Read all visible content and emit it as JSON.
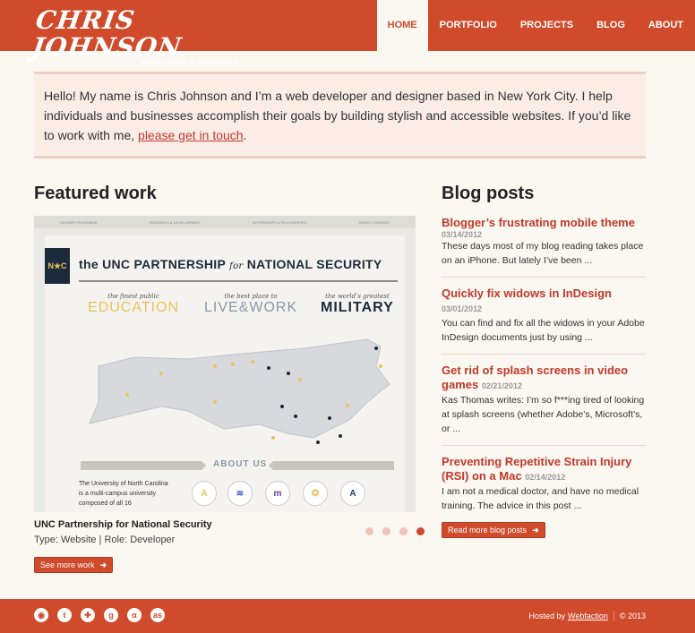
{
  "header": {
    "logo_name": "Chris Johnson",
    "logo_sub": "DEVELOPER & DESIGNER",
    "nav": [
      "HOME",
      "PORTFOLIO",
      "PROJECTS",
      "BLOG",
      "ABOUT"
    ],
    "active": "HOME"
  },
  "intro": {
    "text": "Hello! My name is Chris Johnson and I’m a web developer and designer based in New York City. I help individuals and businesses accomplish their goals by building stylish and accessible websites. If you’d like to work with me, ",
    "link": "please get in touch",
    "end": "."
  },
  "featured": {
    "heading": "Featured work",
    "project_title": "UNC Partnership for National Security",
    "meta": "Type: Website | Role: Developer",
    "button": "See more work",
    "slides_total": 4,
    "slide_active": 4,
    "screenshot": {
      "nav": [
        "DEGREE PROGRAMS",
        "RESEARCH & DEVELOPMENT",
        "INTERNSHIPS & FELLOWSHIPS",
        "SHORT COURSES"
      ],
      "logo": "N★C",
      "title_1": "the UNC PARTNERSHIP",
      "title_for": "for",
      "title_2": "NATIONAL SECURITY",
      "pillars": [
        {
          "small": "the finest public",
          "big": "EDUCATION",
          "color": "#e8c35c"
        },
        {
          "small": "the best place to",
          "big": "LIVE&WORK",
          "color": "#8a98a8"
        },
        {
          "small": "the world’s greatest",
          "big": "MILITARY",
          "color": "#1d2a3a"
        }
      ],
      "about": "ABOUT US",
      "about_text": "The University of North Carolina is a multi-campus university composed of all 16"
    }
  },
  "blog": {
    "heading": "Blog posts",
    "posts": [
      {
        "title": "Blogger’s frustrating mobile theme",
        "date": "03/14/2012",
        "text": "These days most of my blog reading takes place on an iPhone. But lately I’ve been ..."
      },
      {
        "title": "Quickly fix widows in InDesign",
        "date": "03/01/2012",
        "text": "You can find and fix all the widows in your Adobe InDesign documents just by using ..."
      },
      {
        "title": "Get rid of splash screens in video games",
        "date": "02/21/2012",
        "text": "Kas Thomas writes: I’m so f***ing tired of looking at splash screens (whether Adobe’s, Microsoft’s, or ..."
      },
      {
        "title": "Preventing Repetitive Strain Injury (RSI) on a Mac",
        "date": "02/14/2012",
        "text": "I am not a medical doctor, and have no medical training. The advice in this post ..."
      }
    ],
    "button": "Read more blog posts"
  },
  "footer": {
    "social": [
      "rss-icon",
      "twitter-icon",
      "delicious-icon",
      "google-icon",
      "app-net-icon",
      "lastfm-icon"
    ],
    "social_glyphs": [
      "◉",
      "t",
      "✚",
      "g",
      "α",
      "as"
    ],
    "hosted": "Hosted by",
    "host_link": "Webfaction",
    "copyright": "© 2013"
  },
  "colors": {
    "brand": "#d04a2c",
    "background": "#fbf7f1",
    "link": "#c0392b"
  }
}
